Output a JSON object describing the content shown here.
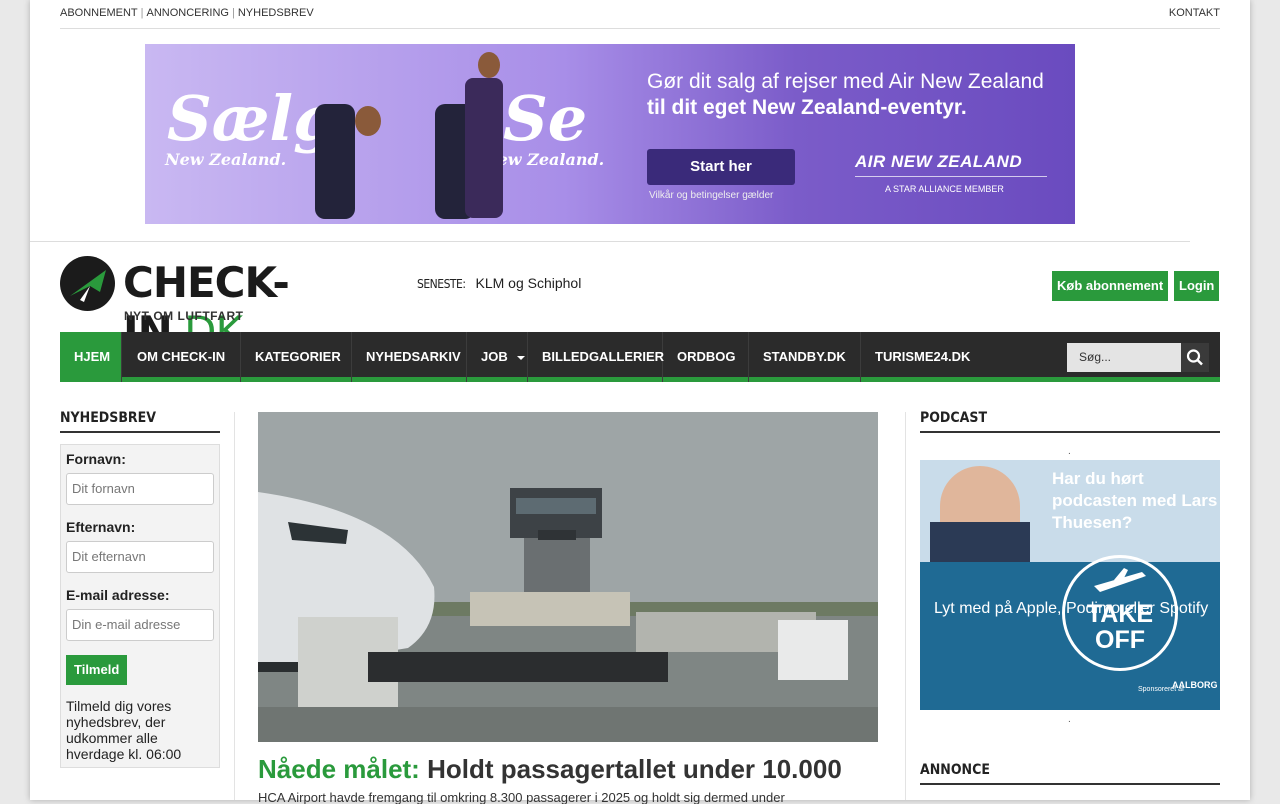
{
  "topbar": {
    "links": [
      "ABONNEMENT",
      "ANNONCERING",
      "NYHEDSBREV"
    ],
    "contact": "KONTAKT"
  },
  "banner": {
    "word1": "Sælg",
    "word1_sub": "New Zealand.",
    "word2": "Se",
    "word2_sub": "New Zealand.",
    "line1": "Gør dit salg af rejser med Air New Zealand",
    "line2": "til dit eget New Zealand-eventyr.",
    "cta": "Start her",
    "terms": "Vilkår og betingelser gælder",
    "brand": "AIR NEW ZEALAND",
    "brand_sub": "A STAR ALLIANCE MEMBER"
  },
  "header": {
    "logo_main": "CHECK-IN",
    "logo_dk": ".DK",
    "logo_tag": "NYT OM LUFTFART",
    "latest_label": "SENESTE:",
    "latest_text": "KLM og Schiphol",
    "subscribe": "Køb abonnement",
    "login": "Login"
  },
  "nav": {
    "items": [
      "HJEM",
      "OM CHECK-IN",
      "KATEGORIER",
      "NYHEDSARKIV",
      "JOB",
      "BILLEDGALLERIER",
      "ORDBOG",
      "STANDBY.DK",
      "TURISME24.DK"
    ],
    "search_placeholder": "Søg..."
  },
  "newsletter": {
    "heading": "NYHEDSBREV",
    "first_label": "Fornavn:",
    "first_placeholder": "Dit fornavn",
    "last_label": "Efternavn:",
    "last_placeholder": "Dit efternavn",
    "email_label": "E-mail adresse:",
    "email_placeholder": "Din e-mail adresse",
    "submit": "Tilmeld",
    "description": "Tilmeld dig vores nyhedsbrev, der udkommer alle hverdage kl. 06:00"
  },
  "article": {
    "kicker": "Nåede målet:",
    "title": "Holdt passagertallet under 10.000",
    "excerpt": "HCA Airport havde fremgang til omkring 8.300 passagerer i 2025 og holdt sig dermed under"
  },
  "podcast": {
    "heading": "PODCAST",
    "question": "Har du hørt podcasten med Lars Thuesen?",
    "listen": "Lyt med på Apple, Podimo eller Spotify",
    "badge_line1": "TAKE",
    "badge_line2": "OFF",
    "sponsor_label": "Sponsoreret af",
    "sponsor": "AALBORG"
  },
  "ad_heading": "ANNONCE",
  "colors": {
    "brand_green": "#2a9a3c",
    "nav_dark": "#2b2b2b"
  }
}
